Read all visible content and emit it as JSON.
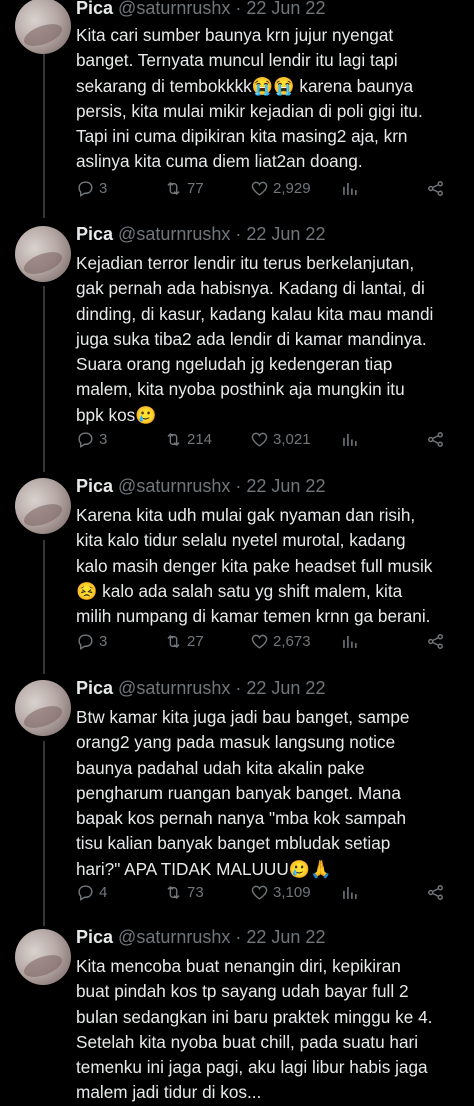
{
  "tweets": [
    {
      "name": "Pica",
      "handle": "@saturnrushx",
      "date": "· 22 Jun 22",
      "text": "Kita cari sumber baunya krn jujur nyengat\nbanget. Ternyata muncul lendir itu lagi tapi\nsekarang di tembokkkk😭😭 karena baunya\npersis, kita mulai mikir kejadian di poli gigi itu.\nTapi ini cuma dipikiran kita masing2 aja, krn\naslinya kita cuma diem liat2an doang.",
      "replies": "3",
      "retweets": "77",
      "likes": "2,929"
    },
    {
      "name": "Pica",
      "handle": "@saturnrushx",
      "date": "· 22 Jun 22",
      "text": "Kejadian terror lendir itu terus berkelanjutan,\ngak pernah ada habisnya. Kadang di lantai, di\ndinding, di kasur, kadang kalau kita mau mandi\njuga suka tiba2 ada lendir di kamar mandinya.\nSuara orang ngeludah jg kedengeran tiap\nmalem, kita nyoba posthink aja mungkin itu\nbpk kos🥲",
      "replies": "3",
      "retweets": "214",
      "likes": "3,021"
    },
    {
      "name": "Pica",
      "handle": "@saturnrushx",
      "date": "· 22 Jun 22",
      "text": "Karena kita udh mulai gak nyaman dan risih,\nkita kalo tidur selalu nyetel murotal, kadang\nkalo masih denger kita pake headset full musik\n😣 kalo ada salah satu yg shift malem, kita\nmilih numpang di kamar temen krnn ga berani.",
      "replies": "3",
      "retweets": "27",
      "likes": "2,673"
    },
    {
      "name": "Pica",
      "handle": "@saturnrushx",
      "date": "· 22 Jun 22",
      "text": "Btw kamar kita juga jadi bau banget, sampe\norang2 yang pada masuk langsung notice\nbaunya padahal udah kita akalin pake\npengharum ruangan banyak banget. Mana\nbapak kos pernah nanya \"mba kok sampah\ntisu kalian banyak banget mbludak setiap\nhari?\" APA TIDAK MALUUU🥲🙏",
      "replies": "4",
      "retweets": "73",
      "likes": "3,109"
    },
    {
      "name": "Pica",
      "handle": "@saturnrushx",
      "date": "· 22 Jun 22",
      "text": "Kita mencoba buat nenangin diri, kepikiran\nbuat pindah kos tp sayang udah bayar full 2\nbulan sedangkan ini baru praktek minggu ke 4.\nSetelah kita nyoba buat chill, pada suatu hari\ntemenku ini jaga pagi, aku lagi libur habis jaga\nmalem jadi tidur di kos...",
      "replies": "",
      "retweets": "",
      "likes": ""
    }
  ],
  "icons": {
    "reply": "reply-icon",
    "retweet": "retweet-icon",
    "like": "heart-icon",
    "views": "analytics-icon",
    "share": "share-icon"
  },
  "colors": {
    "background": "#000000",
    "text": "#e7e9ea",
    "muted": "#71767b",
    "thread": "#333639"
  }
}
